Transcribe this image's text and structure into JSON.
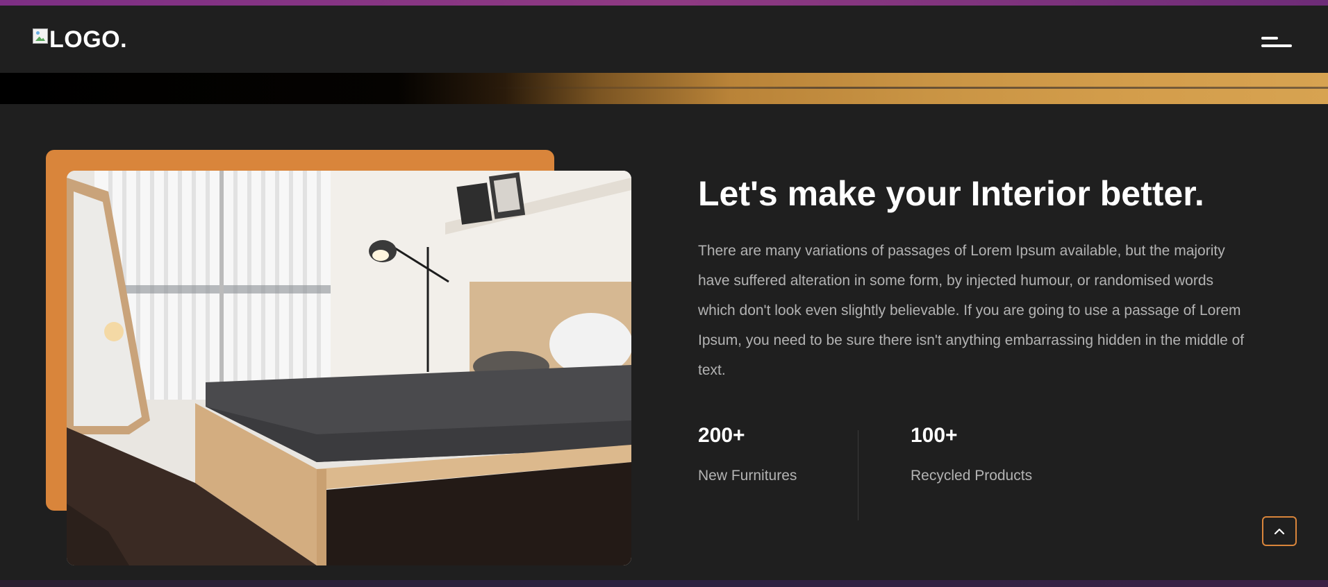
{
  "header": {
    "logo_text": "LOGO.",
    "menu_icon": "hamburger-menu-icon"
  },
  "about": {
    "image_description_icon": "bedroom-photo",
    "title": "Let's make your Interior better.",
    "description": "There are many variations of passages of Lorem Ipsum available, but the majority have suffered alteration in some form, by injected humour, or randomised words which don't look even slightly believable. If you are going to use a passage of Lorem Ipsum, you need to be sure there isn't anything embarrassing hidden in the middle of text.",
    "stats": [
      {
        "number": "200+",
        "label": "New Furnitures"
      },
      {
        "number": "100+",
        "label": "Recycled Products"
      }
    ]
  },
  "scroll_top_icon": "chevron-up-icon",
  "colors": {
    "accent": "#d9853b",
    "background": "#1f1f1f",
    "text_primary": "#ffffff",
    "text_secondary": "#b3b3b3"
  }
}
